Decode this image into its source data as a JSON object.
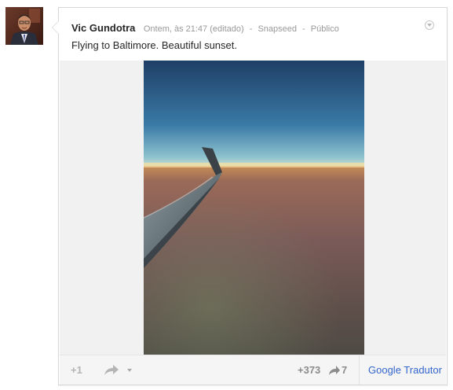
{
  "post": {
    "author": "Vic Gundotra",
    "timestamp": "Ontem, às 21:47 (editado)",
    "app": "Snapseed",
    "visibility": "Público",
    "separator": "-",
    "text": "Flying to Baltimore. Beautiful sunset."
  },
  "actions": {
    "plus_one_label": "+1",
    "plus_count": "+373",
    "share_count": "7",
    "translate_label": "Google Tradutor"
  },
  "colors": {
    "link_blue": "#3366cc",
    "meta_gray": "#999999",
    "count_gray": "#8c8c8c"
  },
  "icons": {
    "menu": "chevron-down-circle-icon",
    "share": "share-arrow-icon",
    "share_dropdown": "caret-down-icon",
    "reshare_count": "reshare-arrow-icon"
  }
}
